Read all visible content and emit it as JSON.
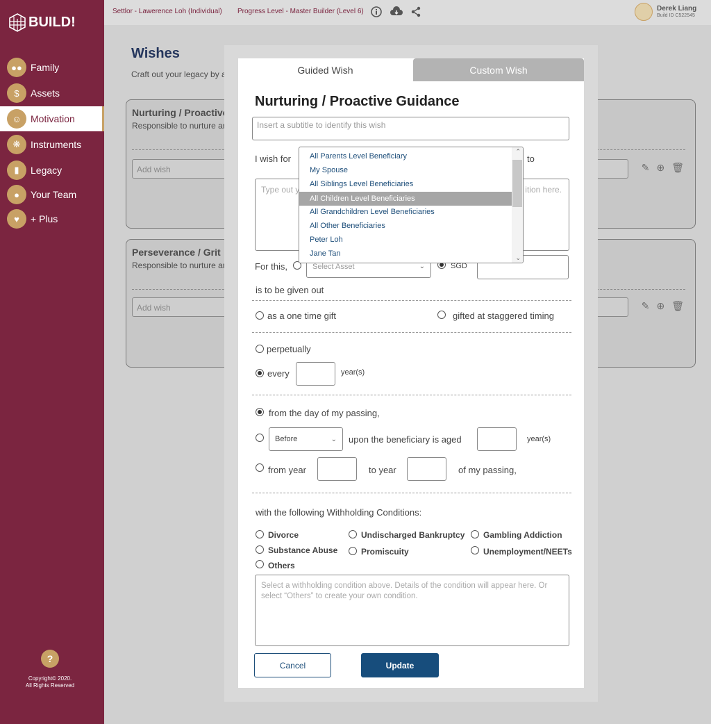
{
  "app": {
    "logo_text": "BUILD!"
  },
  "sidebar": {
    "items": [
      {
        "label": "Family",
        "icon": "family-icon",
        "active": false
      },
      {
        "label": "Assets",
        "icon": "money-bag-icon",
        "active": false
      },
      {
        "label": "Motivation",
        "icon": "motivation-icon",
        "active": true
      },
      {
        "label": "Instruments",
        "icon": "atom-icon",
        "active": false
      },
      {
        "label": "Legacy",
        "icon": "chart-icon",
        "active": false
      },
      {
        "label": "Your Team",
        "icon": "team-icon",
        "active": false
      },
      {
        "label": "+ Plus",
        "icon": "plus-card-icon",
        "active": false
      }
    ],
    "help_glyph": "?",
    "copyright_line1": "Copyright© 2020.",
    "copyright_line2": "All Rights Reserved"
  },
  "topbar": {
    "settlor": "Settlor - Lawerence Loh (Individual)",
    "progress": "Progress Level - Master Builder (Level 6)",
    "user_name": "Derek Liang",
    "build_id": "Build ID C522545"
  },
  "page": {
    "title": "Wishes",
    "subtitle": "Craft out your legacy by addi",
    "cards": [
      {
        "title": "Nurturing / Proactive Gu",
        "desc": "Responsible to nurture and de",
        "add_placeholder": "Add wish"
      },
      {
        "title": "Perseverance / Grit",
        "desc": "Responsible to nurture and de",
        "add_placeholder": "Add wish"
      }
    ]
  },
  "modal": {
    "tabs": [
      "Guided Wish",
      "Custom Wish"
    ],
    "title": "Nurturing / Proactive Guidance",
    "subtitle_placeholder": "Insert a subtitle to identify this wish",
    "i_wish_for": "I wish for",
    "to_label": "to",
    "desc_placeholder_left": "Type out y",
    "desc_placeholder_right": "ition here.",
    "for_this": "For this,",
    "select_asset": "Select Asset",
    "currency": "SGD",
    "given_out": "is to be given out",
    "one_time": "as a one time gift",
    "staggered": "gifted at staggered timing",
    "perpetually": "perpetually",
    "every": "every",
    "years": "year(s)",
    "from_passing": "from the day of my passing,",
    "before_option": "Before",
    "upon_aged": "upon the beneficiary is aged",
    "from_year": "from year",
    "to_year": "to year",
    "of_passing": "of my passing,",
    "withholding_label": "with the following Withholding Conditions:",
    "conditions": [
      "Divorce",
      "Undischarged Bankruptcy",
      "Gambling Addiction",
      "Substance Abuse",
      "Promiscuity",
      "Unemployment/NEETs",
      "Others"
    ],
    "condition_placeholder": "Select a withholding condition above. Details of the condition will appear here. Or select “Others” to create your own condition.",
    "cancel": "Cancel",
    "update": "Update"
  },
  "dropdown": {
    "options": [
      "All Parents Level Beneficiary",
      "My Spouse",
      "All Siblings Level Beneficiaries",
      "All Children Level Beneficiaries",
      "All Grandchildren Level Beneficiaries",
      "All Other Beneficiaries",
      "Peter Loh",
      "Jane Tan"
    ],
    "selected_index": 3
  },
  "colors": {
    "brand": "#7b2540",
    "accent": "#c8a165",
    "primary": "#174d7c"
  }
}
